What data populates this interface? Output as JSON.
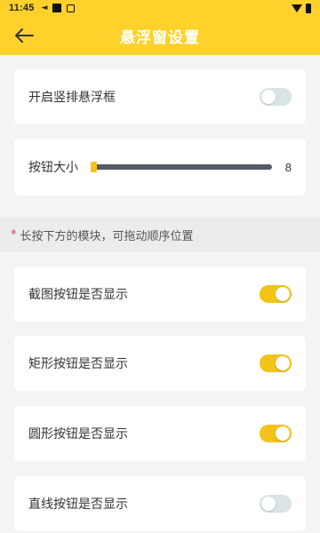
{
  "status_bar": {
    "time": "11:45",
    "icons": [
      "navigation-arrow-icon",
      "notification-square-icon",
      "plus-box-icon",
      "wifi-icon",
      "battery-icon"
    ]
  },
  "header": {
    "title": "悬浮窗设置",
    "back_icon": "back-arrow-icon",
    "background": "#ffd12b"
  },
  "settings": {
    "vertical_float": {
      "label": "开启竖排悬浮框",
      "enabled": false
    },
    "button_size": {
      "label": "按钮大小",
      "value": "8",
      "level": 0.0
    },
    "hint": {
      "marker": "*",
      "text": "长按下方的模块，可拖动顺序位置"
    },
    "items": [
      {
        "label": "截图按钮是否显示",
        "enabled": true
      },
      {
        "label": "矩形按钮是否显示",
        "enabled": true
      },
      {
        "label": "圆形按钮是否显示",
        "enabled": true
      },
      {
        "label": "直线按钮是否显示",
        "enabled": false
      }
    ]
  },
  "colors": {
    "accent": "#f2c318",
    "toggle_off": "#d8e4e6",
    "page_bg": "#f4f4f4"
  }
}
